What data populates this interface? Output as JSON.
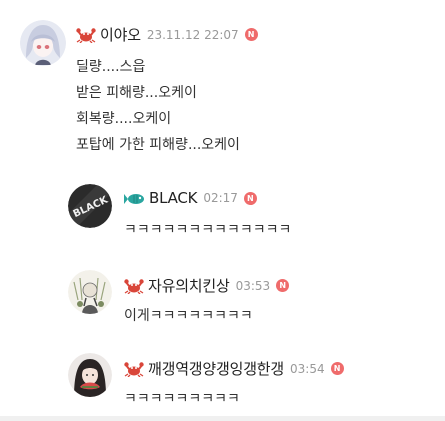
{
  "comments": [
    {
      "nickname": "이야오",
      "time": "23.11.12 22:07",
      "badge": "N",
      "lines": [
        "딜량....스읍",
        "받은 피해량...오케이",
        "회복량....오케이",
        "포탑에 가한 피해량...오케이"
      ],
      "icon": "crab-icon"
    },
    {
      "nickname": "BLACK",
      "time": "02:17",
      "badge": "N",
      "avatar_text": "BLACK",
      "lines": [
        "ㅋㅋㅋㅋㅋㅋㅋㅋㅋㅋㅋㅋㅋ"
      ],
      "icon": "fish-icon"
    },
    {
      "nickname": "자유의치킨상",
      "time": "03:53",
      "badge": "N",
      "lines": [
        "이게ㅋㅋㅋㅋㅋㅋㅋㅋ"
      ],
      "icon": "crab-icon"
    },
    {
      "nickname": "깨갱역갱양갱잉갱한갱",
      "time": "03:54",
      "badge": "N",
      "lines": [
        "ㅋㅋㅋㅋㅋㅋㅋㅋㅋ"
      ],
      "icon": "crab-icon"
    }
  ],
  "colors": {
    "badge": "#ef6b6b",
    "crab": "#d9463a",
    "fish": "#2aa6a0",
    "time": "#999999"
  }
}
